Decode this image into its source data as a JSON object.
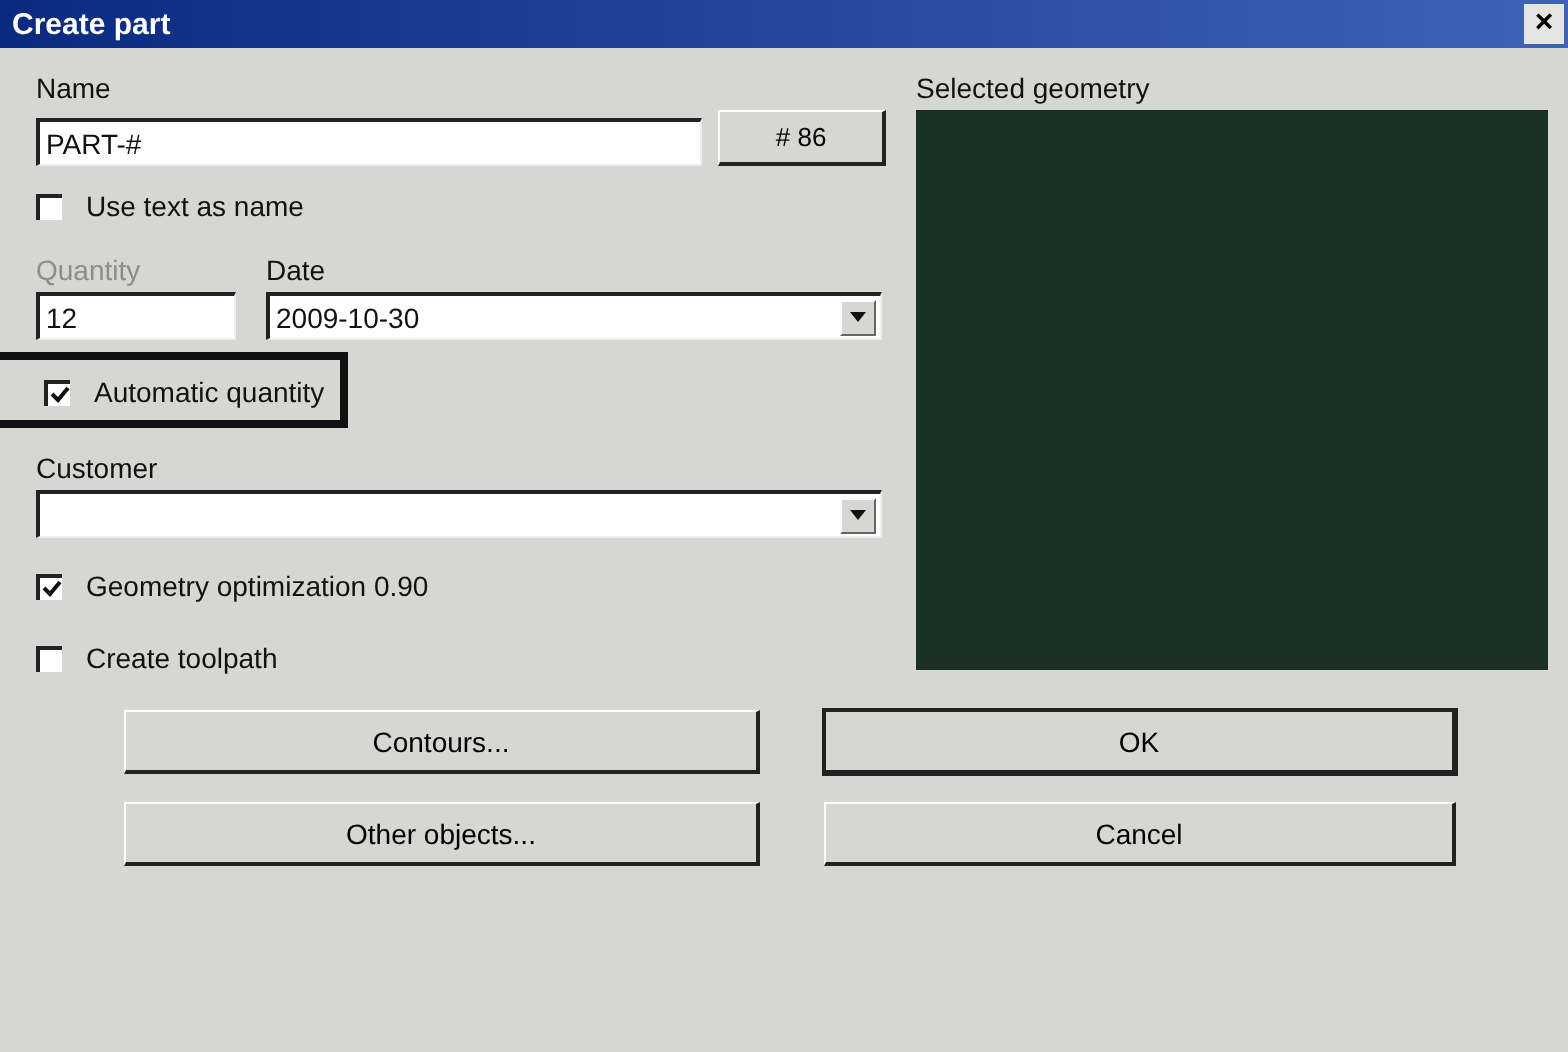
{
  "window": {
    "title": "Create part",
    "close": "×"
  },
  "name": {
    "label": "Name",
    "value": "PART-#",
    "button": "# 86"
  },
  "use_text": {
    "label": "Use text as name",
    "checked": false
  },
  "quantity": {
    "label": "Quantity",
    "disabled": true,
    "value": "12"
  },
  "date": {
    "label": "Date",
    "value": "2009-10-30"
  },
  "auto_quantity": {
    "label": "Automatic quantity",
    "checked": true,
    "highlighted": true
  },
  "customer": {
    "label": "Customer"
  },
  "options": [
    {
      "label": "Geometry optimization 0.90",
      "checked": true
    },
    {
      "label": "Create toolpath",
      "checked": false
    }
  ],
  "preview": {
    "label": "Selected geometry"
  },
  "buttons": [
    {
      "label": "Contours...",
      "default": false
    },
    {
      "label": "OK",
      "default": true
    },
    {
      "label": "Other objects...",
      "default": false
    },
    {
      "label": "Cancel",
      "default": false
    }
  ]
}
